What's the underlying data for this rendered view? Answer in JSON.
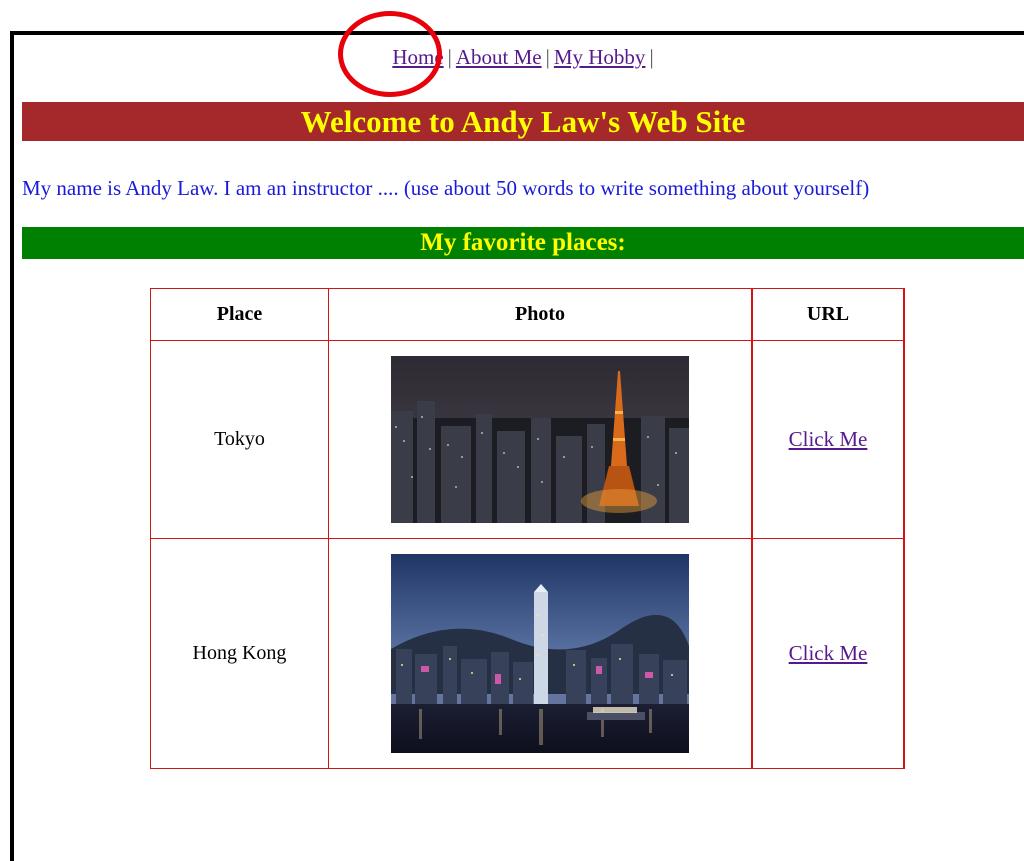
{
  "nav": {
    "items": [
      "Home",
      "About Me",
      "My Hobby"
    ],
    "separator": "|"
  },
  "banner": {
    "title": "Welcome to Andy Law's Web Site"
  },
  "intro": {
    "text": "My name is Andy Law. I am an instructor .... (use about 50 words to write something about yourself)"
  },
  "section": {
    "title": "My favorite places:"
  },
  "table": {
    "headers": [
      "Place",
      "Photo",
      "URL"
    ],
    "rows": [
      {
        "place": "Tokyo",
        "link_label": "Click Me"
      },
      {
        "place": "Hong Kong",
        "link_label": "Click Me"
      }
    ]
  },
  "colors": {
    "banner_bg": "#a5292a",
    "banner_text": "#ffff00",
    "section_bg": "#008000",
    "intro_text": "#1a1adb",
    "table_border": "#d11515",
    "highlight_ring": "#e8000b"
  }
}
